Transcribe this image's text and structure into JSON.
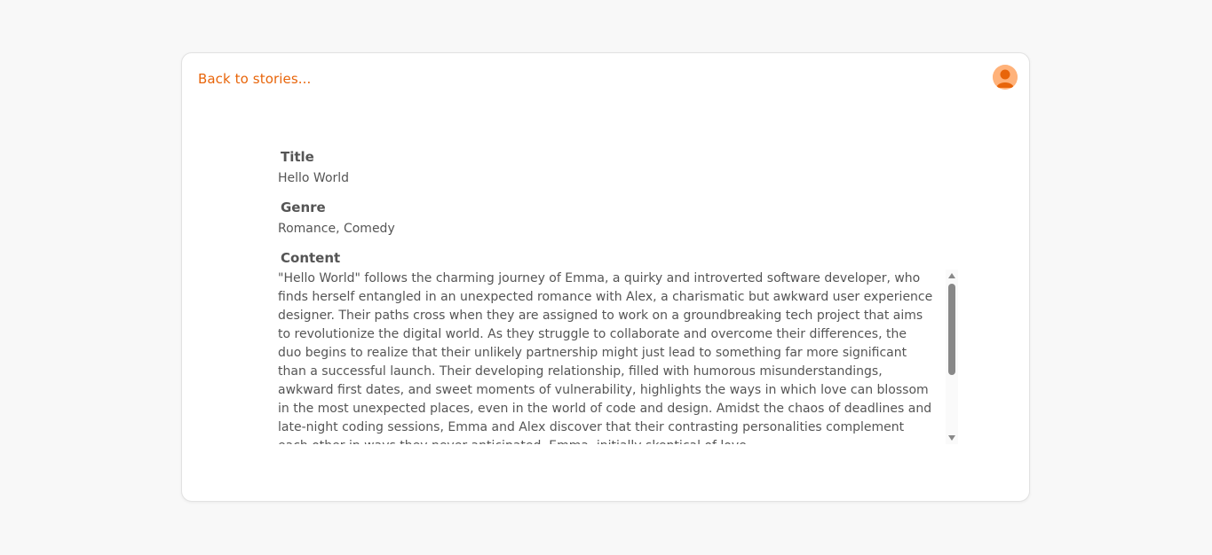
{
  "nav": {
    "back_label": "Back to stories..."
  },
  "user": {
    "avatar_icon": "user-avatar-icon"
  },
  "story": {
    "title_label": "Title",
    "title_value": "Hello World",
    "genre_label": "Genre",
    "genre_value": "Romance, Comedy",
    "content_label": "Content",
    "content_value": "\"Hello World\" follows the charming journey of Emma, a quirky and introverted software developer, who finds herself entangled in an unexpected romance with Alex, a charismatic but awkward user experience designer. Their paths cross when they are assigned to work on a groundbreaking tech project that aims to revolutionize the digital world. As they struggle to collaborate and overcome their differences, the duo begins to realize that their unlikely partnership might just lead to something far more significant than a successful launch. Their developing relationship, filled with humorous misunderstandings, awkward first dates, and sweet moments of vulnerability, highlights the ways in which love can blossom in the most unexpected places, even in the world of code and design. Amidst the chaos of deadlines and late-night coding sessions, Emma and Alex discover that their contrasting personalities complement each other in ways they never anticipated. Emma, initially skeptical of love"
  },
  "colors": {
    "accent": "#e8650a",
    "avatar_bg": "#ffb27a",
    "text": "#555555"
  }
}
